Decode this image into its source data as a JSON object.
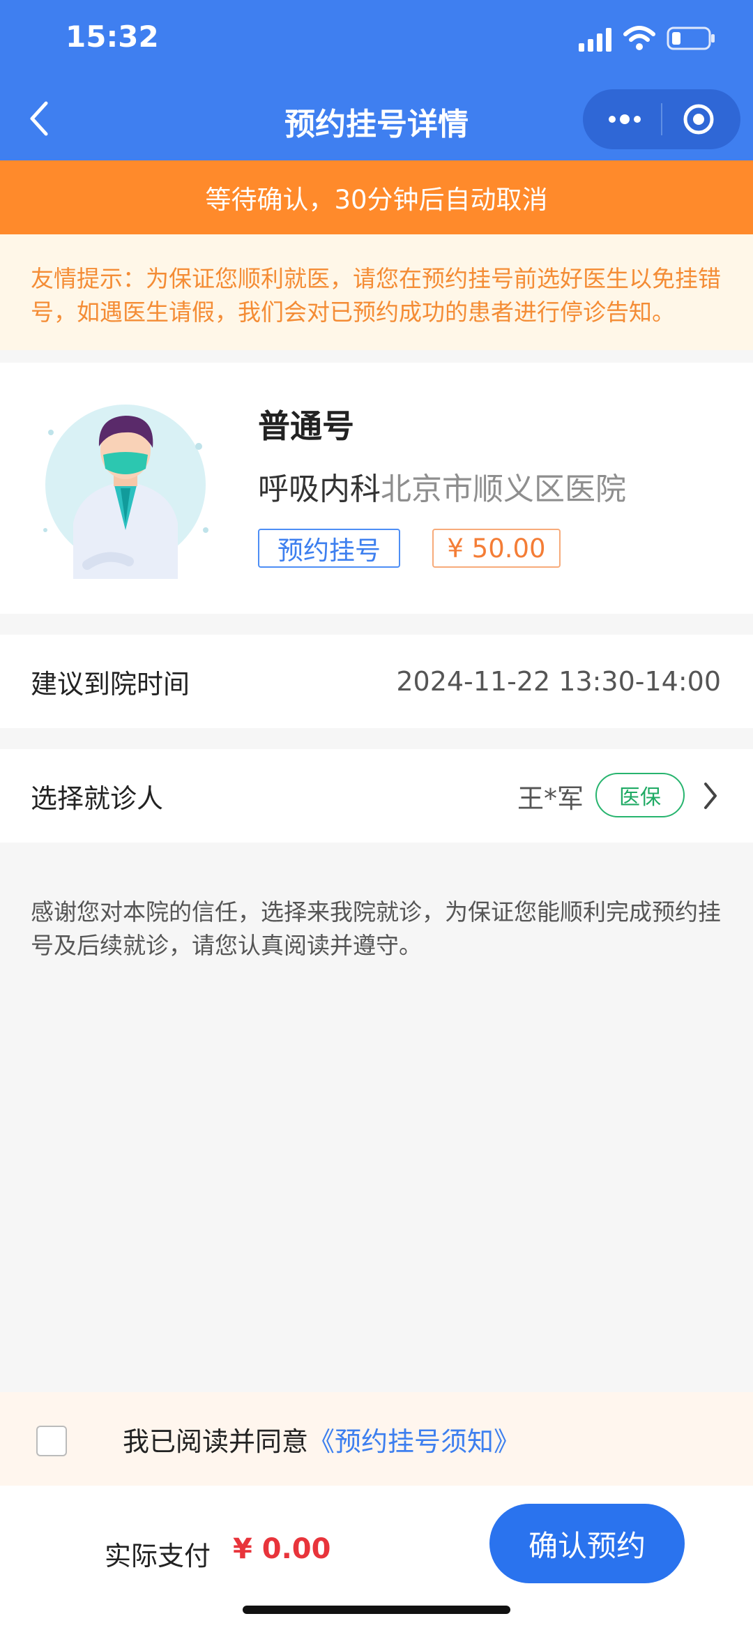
{
  "status_bar": {
    "time": "15:32"
  },
  "nav": {
    "title": "预约挂号详情"
  },
  "banner": {
    "text": "等待确认，30分钟后自动取消"
  },
  "tip": {
    "text": "友情提示：为保证您顺利就医，请您在预约挂号前选好医生以免挂错号，如遇医生请假，我们会对已预约成功的患者进行停诊告知。"
  },
  "doctor_card": {
    "registration_type": "普通号",
    "department": "呼吸内科",
    "hospital": "北京市顺义区医院",
    "tag_label": "预约挂号",
    "price": "¥ 50.00"
  },
  "visit_time": {
    "label": "建议到院时间",
    "value": "2024-11-22 13:30-14:00"
  },
  "patient": {
    "label": "选择就诊人",
    "name": "王*军",
    "insurance_tag": "医保"
  },
  "notice": {
    "text": "感谢您对本院的信任，选择来我院就诊，为保证您能顺利完成预约挂号及后续就诊，请您认真阅读并遵守。"
  },
  "agreement": {
    "prefix": "我已阅读并同意",
    "link": "《预约挂号须知》"
  },
  "footer": {
    "pay_label": "实际支付",
    "pay_amount": "¥ 0.00",
    "confirm_label": "确认预约"
  },
  "colors": {
    "primary": "#3f7ff0",
    "warning": "#ff8a2b",
    "price_red": "#e8343b",
    "insurance_green": "#27b46e"
  }
}
